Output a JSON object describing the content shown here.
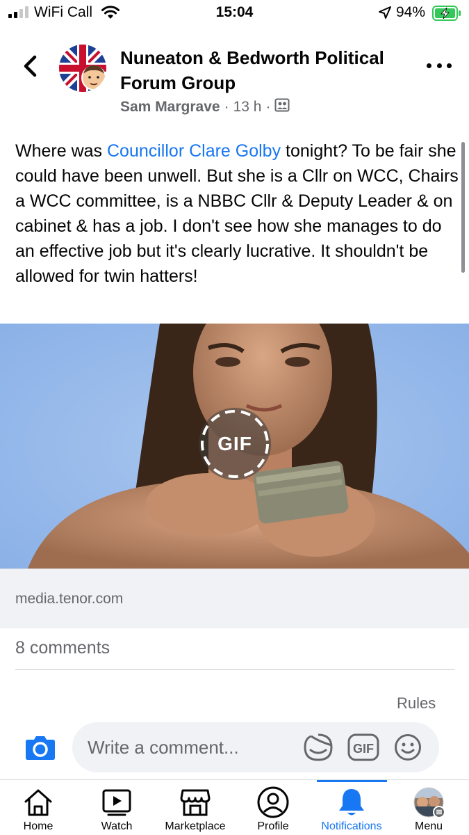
{
  "status_bar": {
    "carrier": "WiFi Call",
    "time": "15:04",
    "battery_percent": "94%"
  },
  "header": {
    "group_name": "Nuneaton & Bedworth Political Forum Group",
    "author": "Sam Margrave",
    "separator": "·",
    "time_ago": "13 h",
    "separator2": "·",
    "audience_icon": "group-audience-icon"
  },
  "post": {
    "text_before": "Where was ",
    "mention": "Councillor Clare Golby",
    "text_after": " tonight? To be fair she could have been unwell. But she is a Cllr on WCC, Chairs a WCC committee, is a NBBC Cllr & Deputy Leader & on cabinet & has a job. I don't see how she manages to do an effective job but it's clearly lucrative. It shouldn't be allowed for twin hatters!",
    "gif_badge": "GIF",
    "link_domain": "media.tenor.com",
    "comments_count": "8 comments",
    "rules_label": "Rules"
  },
  "composer": {
    "placeholder": "Write a comment...",
    "gif_label": "GIF"
  },
  "tabs": [
    {
      "label": "Home",
      "icon": "home-icon"
    },
    {
      "label": "Watch",
      "icon": "watch-icon"
    },
    {
      "label": "Marketplace",
      "icon": "marketplace-icon"
    },
    {
      "label": "Profile",
      "icon": "profile-icon"
    },
    {
      "label": "Notifications",
      "icon": "bell-icon",
      "active": true
    },
    {
      "label": "Menu",
      "icon": "menu-avatar-icon"
    }
  ],
  "colors": {
    "accent": "#1877f2",
    "secondary_text": "#65676b",
    "battery_green": "#34c759"
  }
}
